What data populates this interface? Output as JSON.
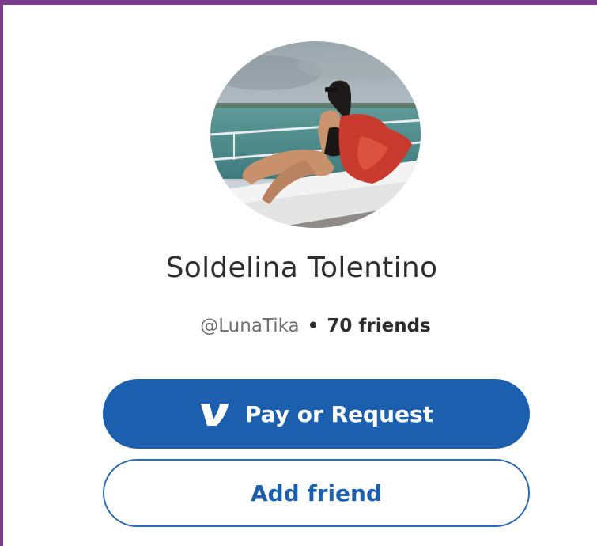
{
  "profile": {
    "name": "Soldelina Tolentino",
    "handle": "@LunaTika",
    "separator": "•",
    "friends": "70 friends"
  },
  "actions": {
    "pay_label": "Pay or Request",
    "add_friend_label": "Add friend"
  },
  "icons": {
    "pay_logo": "venmo-logo-icon"
  },
  "colors": {
    "frame_border": "#7b3b8c",
    "primary_blue": "#1b5fae",
    "name_text": "#2d2d2d",
    "handle_text": "#707070"
  }
}
